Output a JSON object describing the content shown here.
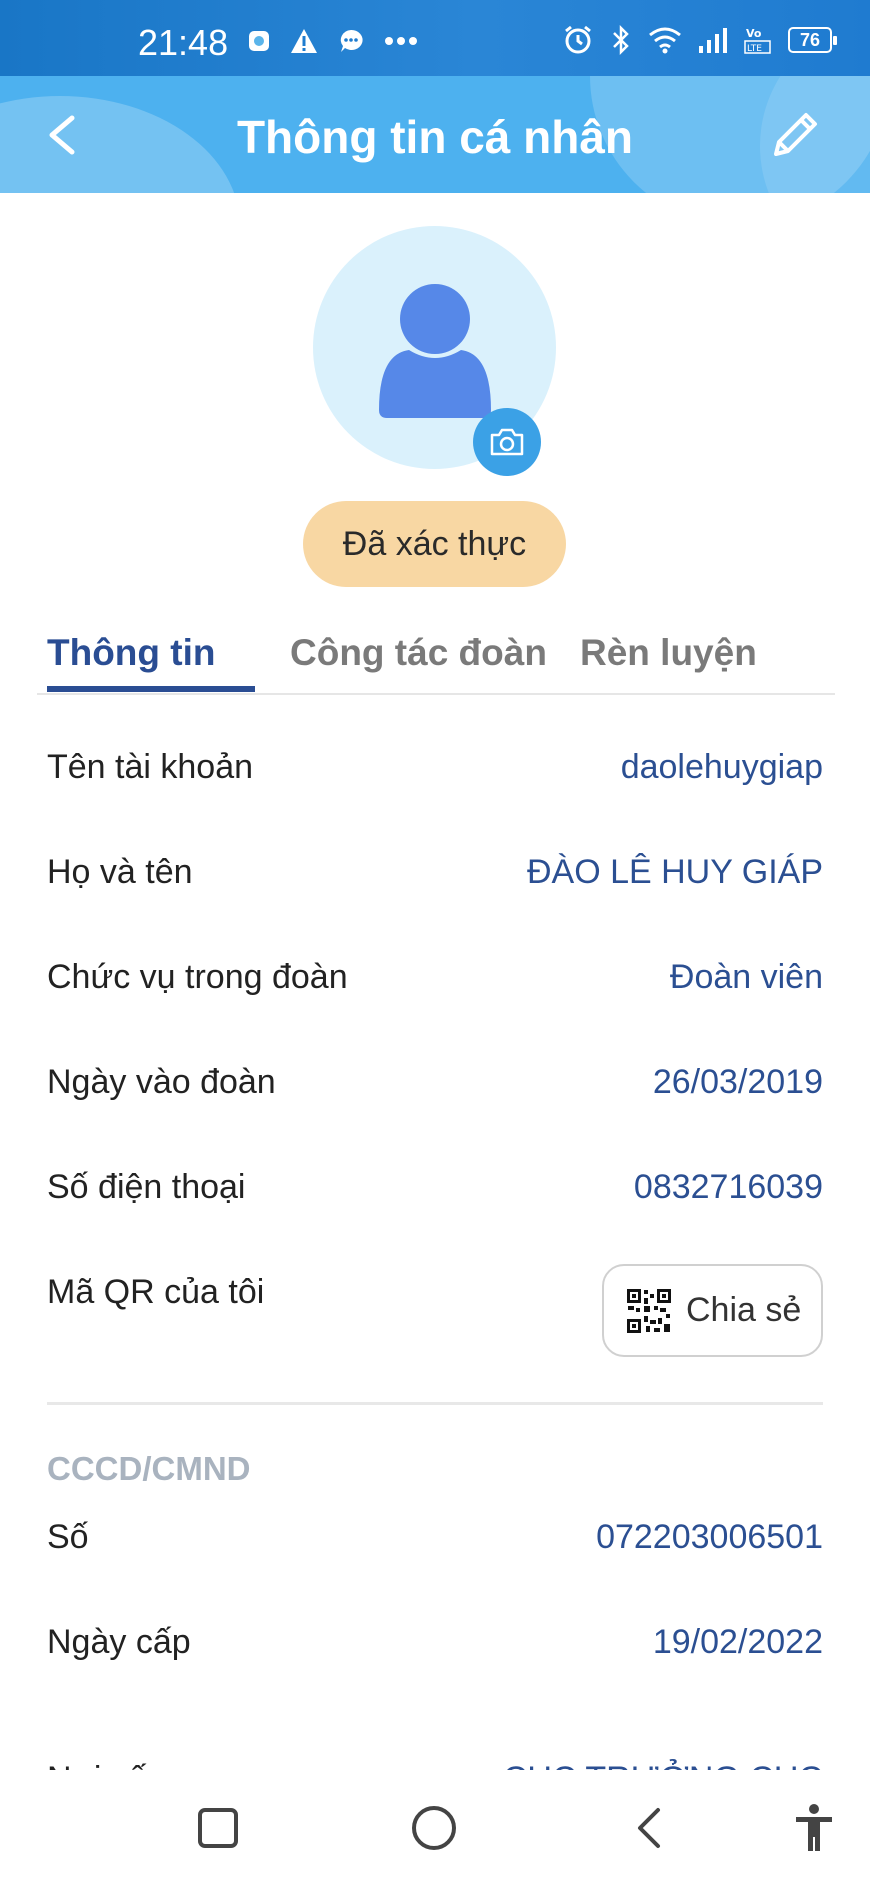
{
  "status_bar": {
    "time": "21:48",
    "battery": "76",
    "left_icons": [
      "app-notification-icon",
      "warning-icon",
      "chat-bubble-icon",
      "more-dots-icon"
    ],
    "right_icons": [
      "alarm-icon",
      "bluetooth-icon",
      "wifi-icon",
      "signal-icon",
      "volte-icon",
      "battery-icon"
    ]
  },
  "header": {
    "title": "Thông tin cá nhân",
    "color": "#4db1ef"
  },
  "profile": {
    "verified_label": "Đã xác thực"
  },
  "tabs": [
    {
      "label": "Thông tin",
      "active": true
    },
    {
      "label": "Công tác đoàn",
      "active": false
    },
    {
      "label": "Rèn luyện",
      "active": false
    }
  ],
  "info": {
    "username": {
      "label": "Tên tài khoản",
      "value": "daolehuygiap"
    },
    "fullname": {
      "label": "Họ và tên",
      "value": "ĐÀO LÊ HUY GIÁP"
    },
    "position": {
      "label": "Chức vụ trong đoàn",
      "value": "Đoàn viên"
    },
    "join_date": {
      "label": "Ngày vào đoàn",
      "value": "26/03/2019"
    },
    "phone": {
      "label": "Số điện thoại",
      "value": "0832716039"
    },
    "qr": {
      "label": "Mã QR của tôi",
      "share_label": "Chia sẻ"
    }
  },
  "id_card": {
    "section_title": "CCCD/CMND",
    "number": {
      "label": "Số",
      "value": "072203006501"
    },
    "issue_date": {
      "label": "Ngày cấp",
      "value": "19/02/2022"
    },
    "issue_place": {
      "label": "Nơi cấp",
      "value": "CỤC TRƯỞNG CỤC"
    }
  },
  "colors": {
    "accent": "#2a4d93",
    "badge": "#f8d7a3",
    "status_bar": "#1976c6"
  }
}
